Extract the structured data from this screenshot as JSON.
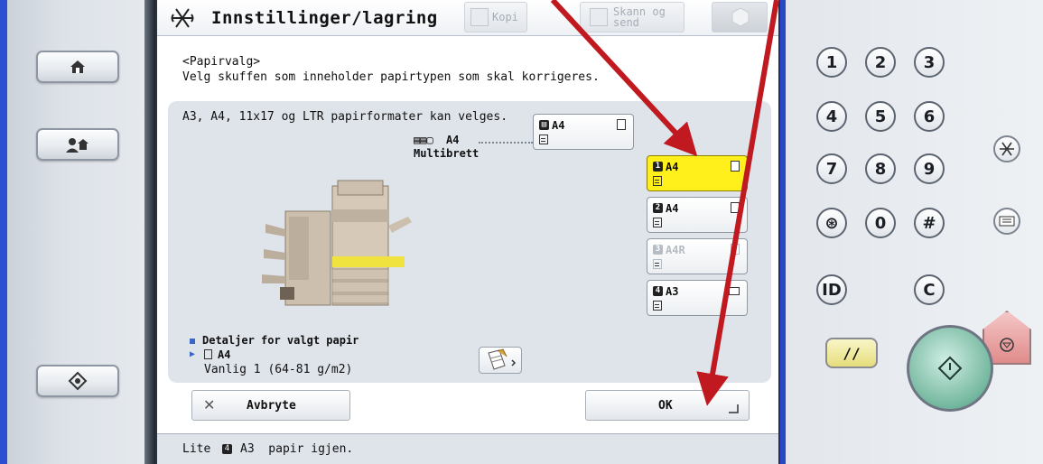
{
  "header": {
    "title": "Innstillinger/lagring",
    "tabs": [
      {
        "label": "Kopi"
      },
      {
        "label": "Skann og\nsend"
      }
    ]
  },
  "instructions": {
    "section": "<Papirvalg>",
    "message": "Velg skuffen som inneholder papirtypen som skal korrigeres."
  },
  "content": {
    "format_note": "A3, A4, 11x17 og LTR papirformater kan velges.",
    "multi_tray": {
      "size": "A4",
      "label": "Multibrett"
    },
    "trays": [
      {
        "num": "",
        "size": "A4",
        "selected": false,
        "disabled": false
      },
      {
        "num": "1",
        "size": "A4",
        "selected": true,
        "disabled": false
      },
      {
        "num": "2",
        "size": "A4",
        "selected": false,
        "disabled": false
      },
      {
        "num": "3",
        "size": "A4R",
        "selected": false,
        "disabled": true
      },
      {
        "num": "4",
        "size": "A3",
        "selected": false,
        "disabled": false
      }
    ],
    "details": {
      "title": "Detaljer for valgt papir",
      "size": "A4",
      "description": "Vanlig 1 (64-81 g/m2)"
    }
  },
  "buttons": {
    "cancel": "Avbryte",
    "ok": "OK"
  },
  "status": {
    "prefix": "Lite",
    "tray_num": "4",
    "message": "A3  papir igjen."
  },
  "keypad": {
    "keys": [
      "1",
      "2",
      "3",
      "4",
      "5",
      "6",
      "7",
      "8",
      "9",
      "⊛",
      "0",
      "#"
    ],
    "id_label": "ID",
    "clear_label": "C",
    "reset_label": "//"
  },
  "colors": {
    "selected_tray": "#ffef1a",
    "annotation_arrow": "#c0191f",
    "bezel_blue": "#2b4fd0"
  }
}
